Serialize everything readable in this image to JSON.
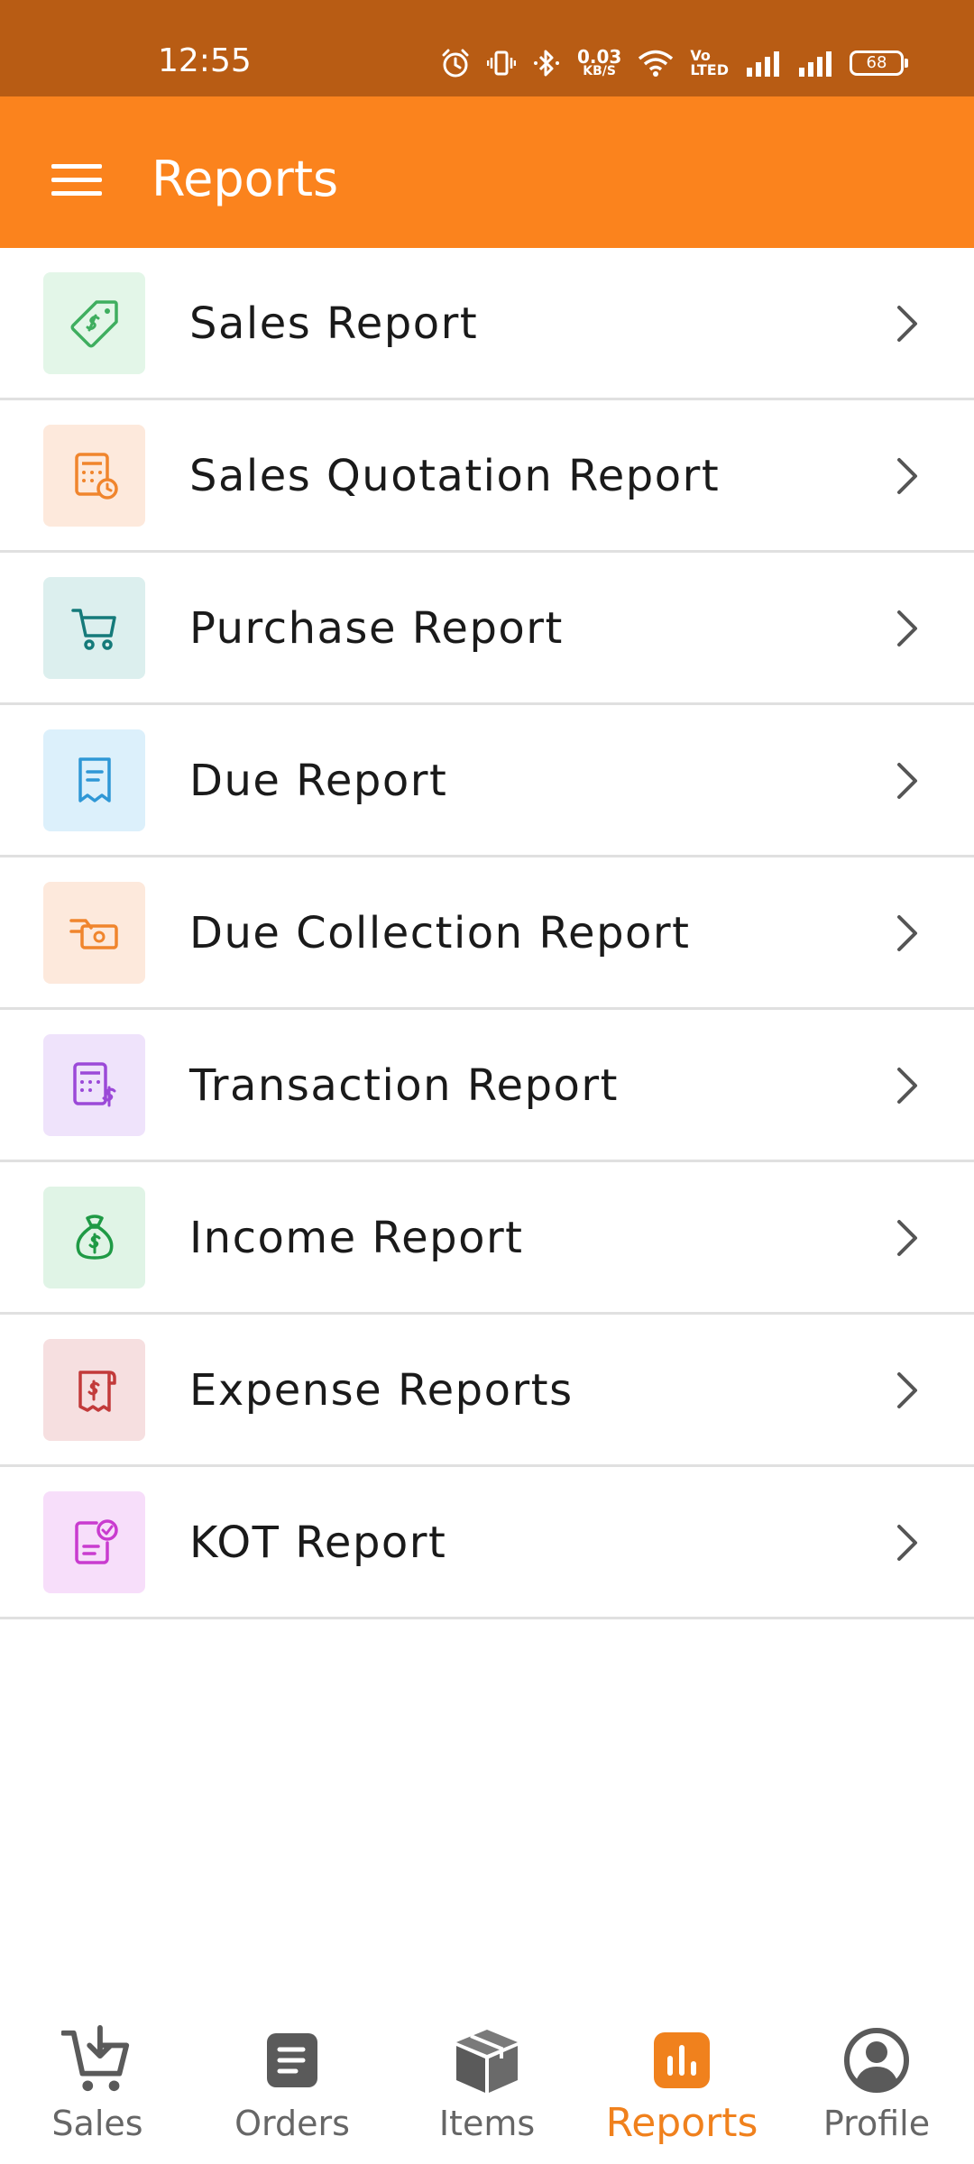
{
  "status_bar": {
    "time": "12:55",
    "net_speed_value": "0.03",
    "net_speed_unit": "KB/S",
    "volte_top": "Vo",
    "volte_bottom": "LTED",
    "battery": "68"
  },
  "app_bar": {
    "title": "Reports",
    "menu_icon": "hamburger-menu-icon",
    "background": "#fb831d"
  },
  "reports": [
    {
      "label": "Sales Report",
      "icon": "price-tag-icon",
      "icon_color": "#3fae5f",
      "tile_color": "#e3f6e8"
    },
    {
      "label": "Sales Quotation Report",
      "icon": "calculator-clock-icon",
      "icon_color": "#f0852d",
      "tile_color": "#fde9dc"
    },
    {
      "label": "Purchase Report",
      "icon": "shopping-cart-icon",
      "icon_color": "#157a7a",
      "tile_color": "#dcefee"
    },
    {
      "label": "Due Report",
      "icon": "receipt-icon",
      "icon_color": "#2f97d6",
      "tile_color": "#dcf0fb"
    },
    {
      "label": "Due Collection Report",
      "icon": "cash-hand-icon",
      "icon_color": "#f0852d",
      "tile_color": "#fde9dc"
    },
    {
      "label": "Transaction Report",
      "icon": "calculator-dollar-icon",
      "icon_color": "#9b49d8",
      "tile_color": "#efe3fb"
    },
    {
      "label": "Income Report",
      "icon": "money-bag-icon",
      "icon_color": "#1f9a45",
      "tile_color": "#e0f4e6"
    },
    {
      "label": "Expense Reports",
      "icon": "bill-dollar-icon",
      "icon_color": "#c23a3a",
      "tile_color": "#f6dfe0"
    },
    {
      "label": "KOT Report",
      "icon": "checklist-icon",
      "icon_color": "#c93bcf",
      "tile_color": "#f7defa"
    }
  ],
  "bottom_nav": {
    "items": [
      {
        "label": "Sales",
        "icon": "cart-download-icon"
      },
      {
        "label": "Orders",
        "icon": "document-list-icon"
      },
      {
        "label": "Items",
        "icon": "box-icon"
      },
      {
        "label": "Reports",
        "icon": "bar-chart-icon"
      },
      {
        "label": "Profile",
        "icon": "user-circle-icon"
      }
    ],
    "active": "Reports",
    "active_color": "#f0811d",
    "inactive_color": "#666666"
  }
}
